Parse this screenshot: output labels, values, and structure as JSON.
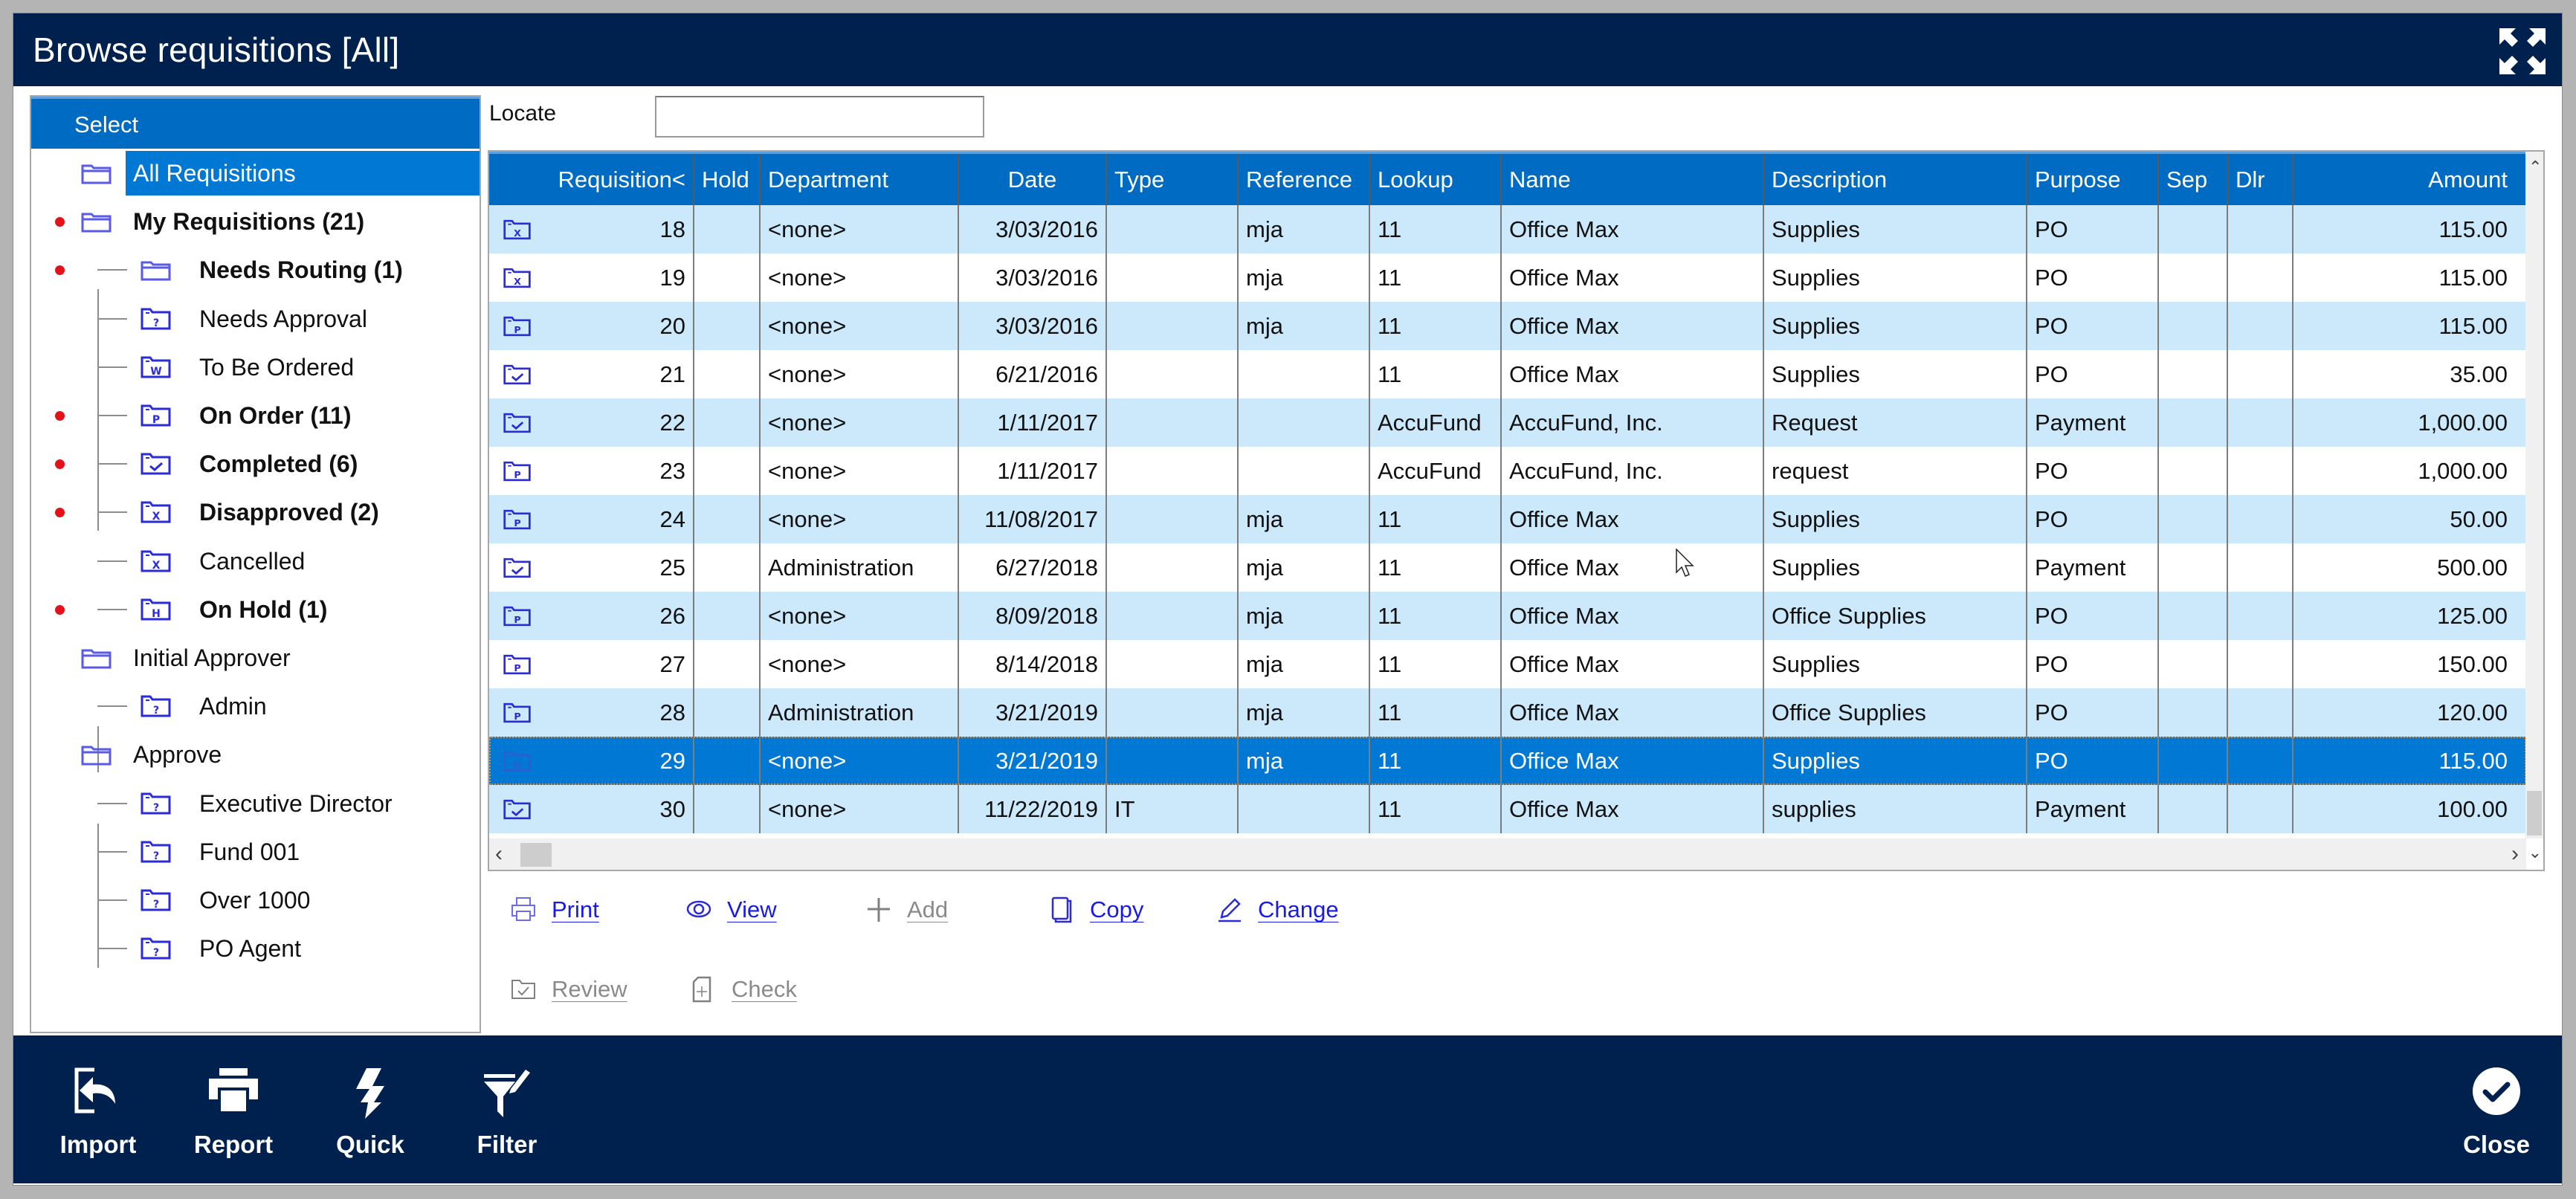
{
  "window": {
    "title": "Browse requisitions [All]",
    "maximize_icon": "expand-arrows-icon"
  },
  "tree": {
    "header": "Select",
    "items": [
      {
        "label": "All Requisitions",
        "level": 0,
        "icon": "folder",
        "bold": false,
        "dot": false,
        "selected": true
      },
      {
        "label": "My Requisitions (21)",
        "level": 0,
        "icon": "folder",
        "bold": true,
        "dot": true,
        "selected": false
      },
      {
        "label": "Needs Routing (1)",
        "level": 1,
        "icon": "folder",
        "bold": true,
        "dot": true,
        "selected": false
      },
      {
        "label": "Needs Approval",
        "level": 1,
        "icon": "?",
        "bold": false,
        "dot": false,
        "selected": false
      },
      {
        "label": "To Be Ordered",
        "level": 1,
        "icon": "W",
        "bold": false,
        "dot": false,
        "selected": false
      },
      {
        "label": "On Order (11)",
        "level": 1,
        "icon": "P",
        "bold": true,
        "dot": true,
        "selected": false
      },
      {
        "label": "Completed (6)",
        "level": 1,
        "icon": "check",
        "bold": true,
        "dot": true,
        "selected": false
      },
      {
        "label": "Disapproved (2)",
        "level": 1,
        "icon": "X",
        "bold": true,
        "dot": true,
        "selected": false
      },
      {
        "label": "Cancelled",
        "level": 1,
        "icon": "X",
        "bold": false,
        "dot": false,
        "selected": false
      },
      {
        "label": "On Hold (1)",
        "level": 1,
        "icon": "H",
        "bold": true,
        "dot": true,
        "selected": false
      },
      {
        "label": "Initial Approver",
        "level": 0,
        "icon": "folder",
        "bold": false,
        "dot": false,
        "selected": false
      },
      {
        "label": "Admin",
        "level": 1,
        "icon": "?",
        "bold": false,
        "dot": false,
        "selected": false
      },
      {
        "label": "Approve",
        "level": 0,
        "icon": "folder",
        "bold": false,
        "dot": false,
        "selected": false
      },
      {
        "label": "Executive Director",
        "level": 1,
        "icon": "?",
        "bold": false,
        "dot": false,
        "selected": false
      },
      {
        "label": "Fund 001",
        "level": 1,
        "icon": "?",
        "bold": false,
        "dot": false,
        "selected": false
      },
      {
        "label": "Over 1000",
        "level": 1,
        "icon": "?",
        "bold": false,
        "dot": false,
        "selected": false
      },
      {
        "label": "PO Agent",
        "level": 1,
        "icon": "?",
        "bold": false,
        "dot": false,
        "selected": false
      }
    ]
  },
  "locate": {
    "label": "Locate",
    "value": "",
    "placeholder": ""
  },
  "grid": {
    "columns": [
      {
        "key": "req",
        "label": "Requisition<",
        "align": "right"
      },
      {
        "key": "hold",
        "label": "Hold",
        "align": "left"
      },
      {
        "key": "dept",
        "label": "Department",
        "align": "left"
      },
      {
        "key": "date",
        "label": "Date",
        "align": "right"
      },
      {
        "key": "type",
        "label": "Type",
        "align": "left"
      },
      {
        "key": "ref",
        "label": "Reference",
        "align": "left"
      },
      {
        "key": "lookup",
        "label": "Lookup",
        "align": "left"
      },
      {
        "key": "name",
        "label": "Name",
        "align": "left"
      },
      {
        "key": "desc",
        "label": "Description",
        "align": "left"
      },
      {
        "key": "purpose",
        "label": "Purpose",
        "align": "left"
      },
      {
        "key": "sep",
        "label": "Sep",
        "align": "left"
      },
      {
        "key": "dlr",
        "label": "Dlr",
        "align": "left"
      },
      {
        "key": "amount",
        "label": "Amount",
        "align": "right"
      }
    ],
    "rows": [
      {
        "status_icon": "X",
        "req": "18",
        "hold": "",
        "dept": "<none>",
        "date": "3/03/2016",
        "type": "",
        "ref": "mja",
        "lookup": "11",
        "name": "Office Max",
        "desc": "Supplies",
        "purpose": "PO",
        "sep": "",
        "dlr": "",
        "amount": "115.00",
        "selected": false
      },
      {
        "status_icon": "X",
        "req": "19",
        "hold": "",
        "dept": "<none>",
        "date": "3/03/2016",
        "type": "",
        "ref": "mja",
        "lookup": "11",
        "name": "Office Max",
        "desc": "Supplies",
        "purpose": "PO",
        "sep": "",
        "dlr": "",
        "amount": "115.00",
        "selected": false
      },
      {
        "status_icon": "P",
        "req": "20",
        "hold": "",
        "dept": "<none>",
        "date": "3/03/2016",
        "type": "",
        "ref": "mja",
        "lookup": "11",
        "name": "Office Max",
        "desc": "Supplies",
        "purpose": "PO",
        "sep": "",
        "dlr": "",
        "amount": "115.00",
        "selected": false
      },
      {
        "status_icon": "check",
        "req": "21",
        "hold": "",
        "dept": "<none>",
        "date": "6/21/2016",
        "type": "",
        "ref": "",
        "lookup": "11",
        "name": "Office Max",
        "desc": "Supplies",
        "purpose": "PO",
        "sep": "",
        "dlr": "",
        "amount": "35.00",
        "selected": false
      },
      {
        "status_icon": "check",
        "req": "22",
        "hold": "",
        "dept": "<none>",
        "date": "1/11/2017",
        "type": "",
        "ref": "",
        "lookup": "AccuFund",
        "name": "AccuFund, Inc.",
        "desc": "Request",
        "purpose": "Payment",
        "sep": "",
        "dlr": "",
        "amount": "1,000.00",
        "selected": false
      },
      {
        "status_icon": "P",
        "req": "23",
        "hold": "",
        "dept": "<none>",
        "date": "1/11/2017",
        "type": "",
        "ref": "",
        "lookup": "AccuFund",
        "name": "AccuFund, Inc.",
        "desc": "request",
        "purpose": "PO",
        "sep": "",
        "dlr": "",
        "amount": "1,000.00",
        "selected": false
      },
      {
        "status_icon": "P",
        "req": "24",
        "hold": "",
        "dept": "<none>",
        "date": "11/08/2017",
        "type": "",
        "ref": "mja",
        "lookup": "11",
        "name": "Office Max",
        "desc": "Supplies",
        "purpose": "PO",
        "sep": "",
        "dlr": "",
        "amount": "50.00",
        "selected": false
      },
      {
        "status_icon": "check",
        "req": "25",
        "hold": "",
        "dept": "Administration",
        "date": "6/27/2018",
        "type": "",
        "ref": "mja",
        "lookup": "11",
        "name": "Office Max",
        "desc": "Supplies",
        "purpose": "Payment",
        "sep": "",
        "dlr": "",
        "amount": "500.00",
        "selected": false
      },
      {
        "status_icon": "P",
        "req": "26",
        "hold": "",
        "dept": "<none>",
        "date": "8/09/2018",
        "type": "",
        "ref": "mja",
        "lookup": "11",
        "name": "Office Max",
        "desc": "Office Supplies",
        "purpose": "PO",
        "sep": "",
        "dlr": "",
        "amount": "125.00",
        "selected": false
      },
      {
        "status_icon": "P",
        "req": "27",
        "hold": "",
        "dept": "<none>",
        "date": "8/14/2018",
        "type": "",
        "ref": "mja",
        "lookup": "11",
        "name": "Office Max",
        "desc": "Supplies",
        "purpose": "PO",
        "sep": "",
        "dlr": "",
        "amount": "150.00",
        "selected": false
      },
      {
        "status_icon": "P",
        "req": "28",
        "hold": "",
        "dept": "Administration",
        "date": "3/21/2019",
        "type": "",
        "ref": "mja",
        "lookup": "11",
        "name": "Office Max",
        "desc": "Office Supplies",
        "purpose": "PO",
        "sep": "",
        "dlr": "",
        "amount": "120.00",
        "selected": false
      },
      {
        "status_icon": "H",
        "req": "29",
        "hold": "",
        "dept": "<none>",
        "date": "3/21/2019",
        "type": "",
        "ref": "mja",
        "lookup": "11",
        "name": "Office Max",
        "desc": "Supplies",
        "purpose": "PO",
        "sep": "",
        "dlr": "",
        "amount": "115.00",
        "selected": true
      },
      {
        "status_icon": "check",
        "req": "30",
        "hold": "",
        "dept": "<none>",
        "date": "11/22/2019",
        "type": "IT",
        "ref": "",
        "lookup": "11",
        "name": "Office Max",
        "desc": "supplies",
        "purpose": "Payment",
        "sep": "",
        "dlr": "",
        "amount": "100.00",
        "selected": false
      }
    ]
  },
  "actions": [
    {
      "label": "Print",
      "icon": "printer-icon",
      "enabled": true
    },
    {
      "label": "View",
      "icon": "eye-icon",
      "enabled": true
    },
    {
      "label": "Add",
      "icon": "plus-icon",
      "enabled": false
    },
    {
      "label": "Copy",
      "icon": "copy-icon",
      "enabled": true
    },
    {
      "label": "Change",
      "icon": "pencil-icon",
      "enabled": true
    },
    {
      "label": "Review",
      "icon": "folder-check-icon",
      "enabled": false
    },
    {
      "label": "Check",
      "icon": "document-plus-icon",
      "enabled": false
    }
  ],
  "bottombar": {
    "buttons": [
      {
        "label": "Import",
        "icon": "import-icon"
      },
      {
        "label": "Report",
        "icon": "printer-icon"
      },
      {
        "label": "Quick",
        "icon": "lightning-icon"
      },
      {
        "label": "Filter",
        "icon": "filter-icon"
      }
    ],
    "close": {
      "label": "Close",
      "icon": "check-circle-icon"
    }
  },
  "colors": {
    "titlebar": "#00204e",
    "header_blue": "#006bc2",
    "selection_blue": "#0078d4",
    "row_alt": "#cce8fb",
    "link_blue": "#1a1ae6",
    "dot_red": "#e3111a",
    "icon_blue": "#2b2bd9"
  }
}
